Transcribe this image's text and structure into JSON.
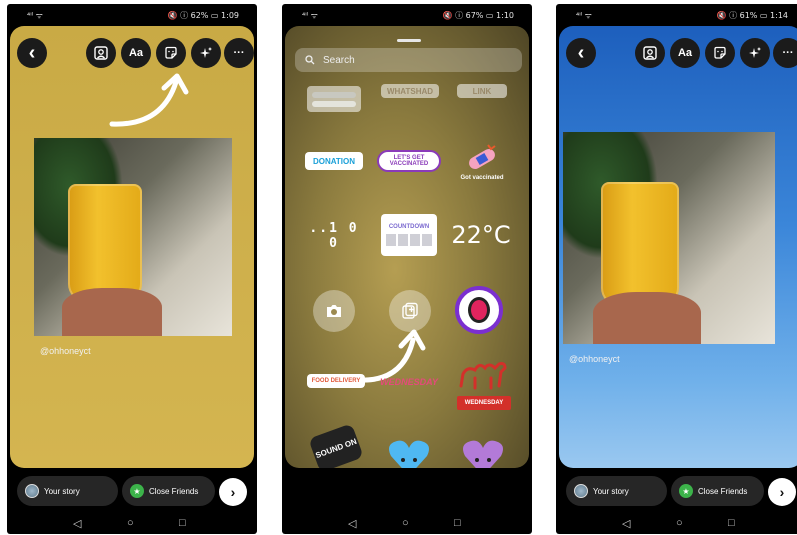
{
  "colors": {
    "yellow_bg": "#cfb04c",
    "blue_bg": "#3b86d9",
    "close_friends_green": "#3cb34a",
    "button_dark": "#1b1b1b"
  },
  "phones": [
    {
      "status": {
        "signal": "⁴ᴵˡ ᯤ",
        "battery_time": "🔇 ⓘ 62% ▭ 1:09"
      },
      "toolbar": {
        "back_icon": "‹",
        "text_label": "Aa",
        "more_icon": "···"
      },
      "handle": "@ohhoneyct",
      "bottom": {
        "your_story": "Your story",
        "close_friends": "Close Friends",
        "next_icon": "›"
      },
      "nav": {
        "back": "◁",
        "home": "○",
        "recent": "□"
      }
    },
    {
      "status": {
        "signal": "⁴ᴵˡ ᯤ",
        "battery_time": "🔇 ⓘ 67% ▭ 1:10"
      },
      "search_placeholder": "Search",
      "stickers": {
        "faded_1": "",
        "faded_2": "WHATSHAD",
        "faded_3": "LINK",
        "donation": "DONATION",
        "vaccinated": "LET'S GET VACCINATED",
        "got_vaccinated": "Got vaccinated",
        "clock": "..1 0 0",
        "countdown": "COUNTDOWN",
        "temperature": "22°C",
        "hashtag": "FOOD DELIVERY",
        "wednesday_script": "WEDNESDAY",
        "wednesday_badge": "WEDNESDAY",
        "sound_on": "SOUND ON"
      },
      "nav": {
        "back": "◁",
        "home": "○",
        "recent": "□"
      }
    },
    {
      "status": {
        "signal": "⁴ᴵˡ ᯤ",
        "battery_time": "🔇 ⓘ 61% ▭ 1:14"
      },
      "toolbar": {
        "back_icon": "‹",
        "text_label": "Aa",
        "more_icon": "···"
      },
      "handle": "@ohhoneyct",
      "bottom": {
        "your_story": "Your story",
        "close_friends": "Close Friends",
        "next_icon": "›"
      },
      "nav": {
        "back": "◁",
        "home": "○",
        "recent": "□"
      }
    }
  ]
}
